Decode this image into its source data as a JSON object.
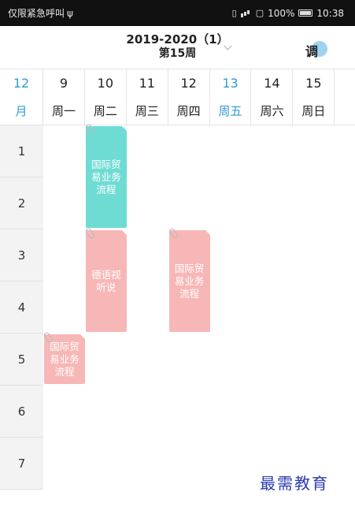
{
  "status_bar": {
    "left_text": "仅限紧急呼叫",
    "usb_symbol": "ψ",
    "battery_text": "100%",
    "time": "10:38",
    "icons": [
      "vibrate-icon",
      "wifi-icon",
      "sim-icon",
      "battery-icon"
    ]
  },
  "header": {
    "term": "2019-2020（1）",
    "week": "第15周",
    "adjust_label": "调"
  },
  "month": {
    "number": "12",
    "label": "月"
  },
  "days": [
    {
      "date": "9",
      "weekday": "周一"
    },
    {
      "date": "10",
      "weekday": "周二"
    },
    {
      "date": "11",
      "weekday": "周三"
    },
    {
      "date": "12",
      "weekday": "周四"
    },
    {
      "date": "13",
      "weekday": "周五",
      "today": true
    },
    {
      "date": "14",
      "weekday": "周六"
    },
    {
      "date": "15",
      "weekday": "周日"
    }
  ],
  "periods": [
    "1",
    "2",
    "3",
    "4",
    "5",
    "6",
    "7"
  ],
  "courses": [
    {
      "name": "国际贸易业务流程",
      "day": 2,
      "start": 1,
      "span": 2,
      "color": "#6fdcd4"
    },
    {
      "name": "德语视听说",
      "day": 2,
      "start": 3,
      "span": 2,
      "color": "#f7b7b6"
    },
    {
      "name": "国际贸易业务流程",
      "day": 4,
      "start": 3,
      "span": 2,
      "color": "#f7b7b6"
    },
    {
      "name": "国际贸易业务流程",
      "day": 1,
      "start": 5,
      "span": 1,
      "color": "#f7b7b6"
    }
  ],
  "watermark": "最需教育",
  "accent_color": "#2f9bd6"
}
